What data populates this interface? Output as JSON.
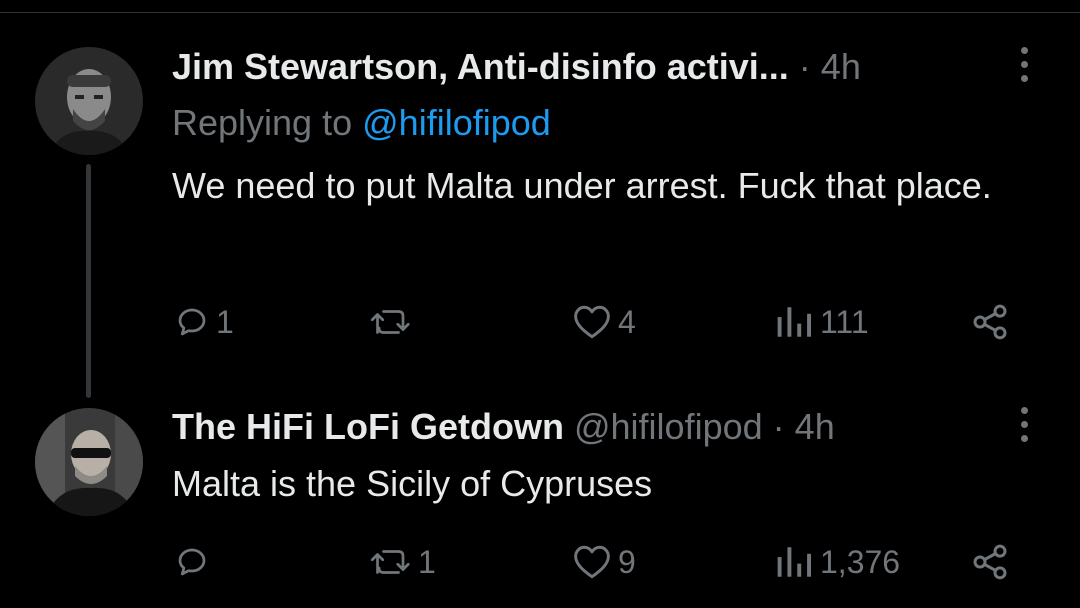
{
  "tweets": [
    {
      "author": "Jim Stewartson, Anti-disinfo activi...",
      "separator": "·",
      "time": "4h",
      "replying_prefix": "Replying to",
      "replying_handle": "@hifilofipod",
      "text": "We need to put Malta under arrest. Fuck that place.",
      "actions": {
        "replies": "1",
        "reposts": "",
        "likes": "4",
        "views": "111"
      }
    },
    {
      "author": "The HiFi LoFi Getdown",
      "handle": "@hifilofipod",
      "separator": "·",
      "time": "4h",
      "text": "Malta is the Sicily of Cypruses",
      "actions": {
        "replies": "",
        "reposts": "1",
        "likes": "9",
        "views": "1,376"
      }
    }
  ]
}
